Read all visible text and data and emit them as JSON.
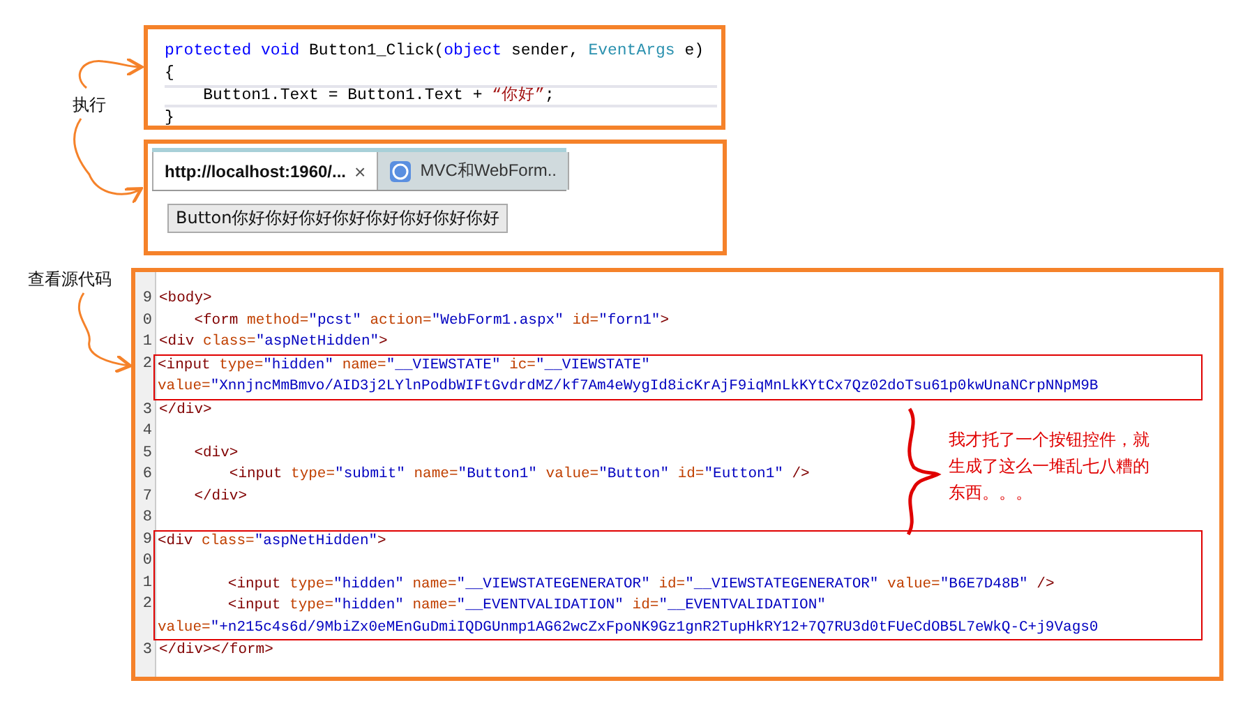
{
  "annotations": [
    {
      "kind": "execute",
      "text": "执行"
    },
    {
      "kind": "view_source",
      "text": "查看源代码"
    }
  ],
  "code_editor": {
    "lines": [
      {
        "current": false,
        "tokens": [
          {
            "kind": "keyword",
            "text": "protected void"
          },
          {
            "kind": "plain",
            "text": " Button1_Click("
          },
          {
            "kind": "keyword",
            "text": "object"
          },
          {
            "kind": "plain",
            "text": " sender, "
          },
          {
            "kind": "type",
            "text": "EventArgs"
          },
          {
            "kind": "plain",
            "text": " e)"
          }
        ]
      },
      {
        "current": false,
        "tokens": [
          {
            "kind": "plain",
            "text": "{"
          }
        ]
      },
      {
        "current": true,
        "tokens": [
          {
            "kind": "plain",
            "text": "    Button1.Text = Button1.Text + "
          },
          {
            "kind": "string",
            "text": "“你好”"
          },
          {
            "kind": "plain",
            "text": ";"
          }
        ]
      },
      {
        "current": false,
        "tokens": [
          {
            "kind": "plain",
            "text": "}"
          }
        ]
      }
    ]
  },
  "browser": {
    "tabs": [
      {
        "label": "http://localhost:1960/...",
        "selected": true,
        "close": "×"
      },
      {
        "label": "MVC和WebForm..",
        "selected": false
      }
    ],
    "page_button": "Button你好你好你好你好你好你好你好你好"
  },
  "source_view": {
    "blocks": [
      {
        "kind": "plain",
        "lines": [
          {
            "number": "9",
            "tokens": [
              {
                "kind": "tag",
                "text": "<body>"
              }
            ]
          },
          {
            "number": "0",
            "tokens": [
              {
                "kind": "tag",
                "text": "    <form"
              },
              {
                "kind": "attr",
                "text": " method="
              },
              {
                "kind": "value",
                "text": "\"pcst\""
              },
              {
                "kind": "attr",
                "text": " action="
              },
              {
                "kind": "value",
                "text": "\"WebForm1.aspx\""
              },
              {
                "kind": "attr",
                "text": " id="
              },
              {
                "kind": "value",
                "text": "\"forn1\""
              },
              {
                "kind": "tag",
                "text": ">"
              }
            ]
          },
          {
            "number": "1",
            "tokens": [
              {
                "kind": "tag",
                "text": "<div"
              },
              {
                "kind": "attr",
                "text": " class="
              },
              {
                "kind": "value",
                "text": "\"aspNetHidden\""
              },
              {
                "kind": "tag",
                "text": ">"
              }
            ]
          }
        ]
      },
      {
        "kind": "highlighted",
        "lines": [
          {
            "number": "2",
            "tokens": [
              {
                "kind": "tag",
                "text": "<input"
              },
              {
                "kind": "attr",
                "text": " type="
              },
              {
                "kind": "value",
                "text": "\"hidden\""
              },
              {
                "kind": "attr",
                "text": " name="
              },
              {
                "kind": "value",
                "text": "\"__VIEWSTATE\""
              },
              {
                "kind": "attr",
                "text": " ic="
              },
              {
                "kind": "value",
                "text": "\"__VIEWSTATE\""
              }
            ]
          },
          {
            "tokens": [
              {
                "kind": "attr",
                "text": "value="
              },
              {
                "kind": "value",
                "text": "\"XnnjncMmBmvo/AID3j2LYlnPodbWIFtGvdrdMZ/kf7Am4eWygId8icKrAjF9iqMnLkKYtCx7Qz02doTsu61p0kwUnaNCrpNNpM9B"
              }
            ]
          }
        ]
      },
      {
        "kind": "plain",
        "lines": [
          {
            "number": "3",
            "tokens": [
              {
                "kind": "tag",
                "text": "</div>"
              }
            ]
          },
          {
            "number": "4"
          },
          {
            "number": "5",
            "tokens": [
              {
                "kind": "tag",
                "text": "    <div>"
              }
            ]
          },
          {
            "number": "6",
            "tokens": [
              {
                "kind": "tag",
                "text": "        <input"
              },
              {
                "kind": "attr",
                "text": " type="
              },
              {
                "kind": "value",
                "text": "\"submit\""
              },
              {
                "kind": "attr",
                "text": " name="
              },
              {
                "kind": "value",
                "text": "\"Button1\""
              },
              {
                "kind": "attr",
                "text": " value="
              },
              {
                "kind": "value",
                "text": "\"Button\""
              },
              {
                "kind": "attr",
                "text": " id="
              },
              {
                "kind": "value",
                "text": "\"Eutton1\""
              },
              {
                "kind": "tag",
                "text": " />"
              }
            ]
          },
          {
            "number": "7",
            "tokens": [
              {
                "kind": "tag",
                "text": "    </div>"
              }
            ]
          },
          {
            "number": "8"
          }
        ]
      },
      {
        "kind": "highlighted",
        "lines": [
          {
            "number": "9",
            "tokens": [
              {
                "kind": "tag",
                "text": "<div"
              },
              {
                "kind": "attr",
                "text": " class="
              },
              {
                "kind": "value",
                "text": "\"aspNetHidden\""
              },
              {
                "kind": "tag",
                "text": ">"
              }
            ]
          },
          {
            "number": "0"
          },
          {
            "number": "1",
            "tokens": [
              {
                "kind": "tag",
                "text": "        <input"
              },
              {
                "kind": "attr",
                "text": " type="
              },
              {
                "kind": "value",
                "text": "\"hidden\""
              },
              {
                "kind": "attr",
                "text": " name="
              },
              {
                "kind": "value",
                "text": "\"__VIEWSTATEGENERATOR\""
              },
              {
                "kind": "attr",
                "text": " id="
              },
              {
                "kind": "value",
                "text": "\"__VIEWSTATEGENERATOR\""
              },
              {
                "kind": "attr",
                "text": " value="
              },
              {
                "kind": "value",
                "text": "\"B6E7D48B\""
              },
              {
                "kind": "tag",
                "text": " />"
              }
            ]
          },
          {
            "number": "2",
            "tokens": [
              {
                "kind": "tag",
                "text": "        <input"
              },
              {
                "kind": "attr",
                "text": " type="
              },
              {
                "kind": "value",
                "text": "\"hidden\""
              },
              {
                "kind": "attr",
                "text": " name="
              },
              {
                "kind": "value",
                "text": "\"__EVENTVALIDATION\""
              },
              {
                "kind": "attr",
                "text": " id="
              },
              {
                "kind": "value",
                "text": "\"__EVENTVALIDATION\""
              }
            ]
          },
          {
            "tokens": [
              {
                "kind": "attr",
                "text": "value="
              },
              {
                "kind": "value",
                "text": "\"+n215c4s6d/9MbiZx0eMEnGuDmiIQDGUnmp1AG62wcZxFpoNK9Gz1gnR2TupHkRY12+7Q7RU3d0tFUeCdOB5L7eWkQ-C+j9Vags0"
              }
            ]
          }
        ]
      },
      {
        "kind": "plain",
        "lines": [
          {
            "number": "3",
            "tokens": [
              {
                "kind": "tag",
                "text": "</div></form>"
              }
            ]
          }
        ]
      }
    ]
  },
  "callout": "我才托了一个按钮控件，就生成了这么一堆乱七八糟的东西。。。"
}
